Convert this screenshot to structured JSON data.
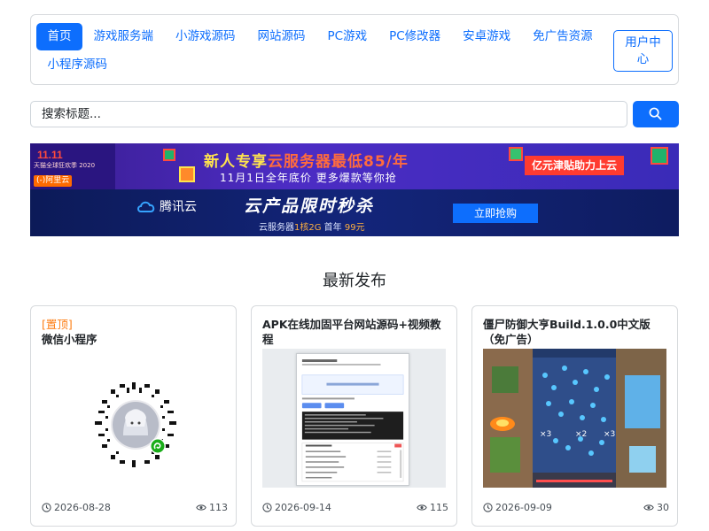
{
  "nav": {
    "items": [
      {
        "label": "首页",
        "active": true
      },
      {
        "label": "游戏服务端"
      },
      {
        "label": "小游戏源码"
      },
      {
        "label": "网站源码"
      },
      {
        "label": "PC游戏"
      },
      {
        "label": "PC修改器"
      },
      {
        "label": "安卓游戏"
      },
      {
        "label": "免广告资源"
      },
      {
        "label": "小程序源码"
      }
    ],
    "user_center": "用户中心"
  },
  "search": {
    "placeholder": "搜索标题..."
  },
  "banners": {
    "aliyun": {
      "badge": "11.11",
      "badge_sub": "天猫全球狂欢季 2020",
      "logo": "(-)阿里云",
      "title_a": "新人专享",
      "title_b": "云服务器最低85/年",
      "subtitle": "11月1日全年底价 更多爆款等你抢",
      "right_tag": "亿元津贴助力上云"
    },
    "tencent": {
      "logo": "腾讯云",
      "title": "云产品限时秒杀",
      "sub_a": "云服务器",
      "sub_spec": "1核2G",
      "sub_b": " 首年 ",
      "sub_price": "99元",
      "cta": "立即抢购"
    }
  },
  "section": {
    "title": "最新发布"
  },
  "cards": [
    {
      "pin": "[置顶]",
      "title": "微信小程序",
      "date": "2026-08-28",
      "views": "113"
    },
    {
      "title": "APK在线加固平台网站源码+视频教程",
      "date": "2026-09-14",
      "views": "115"
    },
    {
      "title": "僵尸防御大亨Build.1.0.0中文版（免广告）",
      "date": "2026-09-09",
      "views": "30"
    }
  ],
  "colors": {
    "primary": "#0d6efd",
    "pin": "#fd7e14"
  },
  "icons": {
    "search": "search-icon",
    "clock": "clock-icon",
    "eye": "eye-icon"
  }
}
